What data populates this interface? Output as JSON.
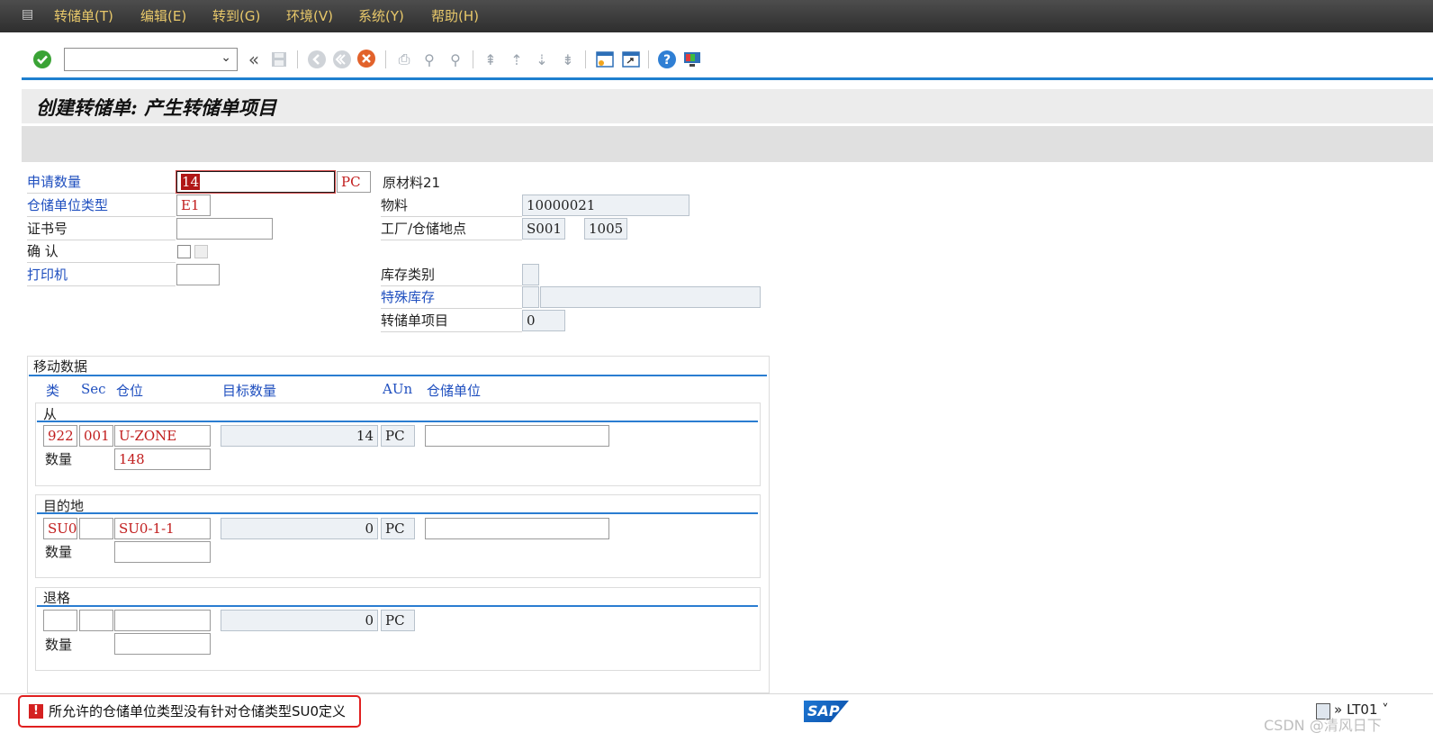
{
  "menu": {
    "items": [
      "转储单(T)",
      "编辑(E)",
      "转到(G)",
      "环境(V)",
      "系统(Y)",
      "帮助(H)"
    ]
  },
  "toolbar": {
    "command_value": ""
  },
  "page_title": "创建转储单: 产生转储单项目",
  "header": {
    "qty_label": "申请数量",
    "qty_value": "14",
    "qty_unit": "PC",
    "su_type_label": "仓储单位类型",
    "su_type_value": "E1",
    "cert_label": "证书号",
    "cert_value": "",
    "confirm_label": "确 认",
    "printer_label": "打印机",
    "printer_value": "",
    "material_desc": "原材料21",
    "material_label": "物料",
    "material_value": "10000021",
    "plant_label": "工厂/仓储地点",
    "plant_value": "S001",
    "sloc_value": "1005",
    "stock_cat_label": "库存类别",
    "stock_cat_value": "",
    "special_stock_label": "特殊库存",
    "special_stock_value": "",
    "special_stock_num": "",
    "to_item_label": "转储单项目",
    "to_item_value": "0"
  },
  "movement": {
    "title": "移动数据",
    "columns": {
      "type": "类",
      "sec": "Sec",
      "bin": "仓位",
      "target_qty": "目标数量",
      "aun": "AUn",
      "su": "仓储单位"
    },
    "from": {
      "title": "从",
      "type": "922",
      "sec": "001",
      "bin": "U-ZONE",
      "target_qty": "14",
      "aun": "PC",
      "su": "",
      "qty_label": "数量",
      "qty": "148"
    },
    "dest": {
      "title": "目的地",
      "type": "SU0",
      "sec": "",
      "bin": "SU0-1-1",
      "target_qty": "0",
      "aun": "PC",
      "su": "",
      "qty_label": "数量",
      "qty": ""
    },
    "ret": {
      "title": "退格",
      "type": "",
      "sec": "",
      "bin": "",
      "target_qty": "0",
      "aun": "PC",
      "qty_label": "数量",
      "qty": ""
    }
  },
  "status": {
    "message": "所允许的仓储单位类型没有针对仓储类型SU0定义",
    "logo": "SAP",
    "system": "» LT01 ˅"
  },
  "watermark": "CSDN @清风日下",
  "colors": {
    "menu_text": "#e8c86a",
    "accent_line": "#1e7fcf",
    "label_blue": "#1f4fbf",
    "value_red": "#c11d1d",
    "error_red": "#e02020"
  }
}
